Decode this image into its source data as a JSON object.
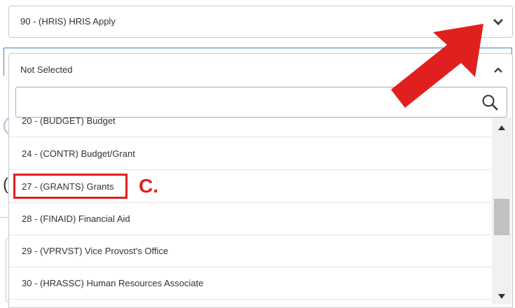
{
  "top_select": {
    "value": "90 - (HRIS) HRIS Apply",
    "icon": "chevron-down-icon"
  },
  "open_select": {
    "value": "Not Selected",
    "icon": "chevron-up-icon"
  },
  "search": {
    "placeholder": "",
    "icon": "search-icon"
  },
  "options": [
    "20 - (BUDGET) Budget",
    "24 - (CONTR) Budget/Grant",
    "27 - (GRANTS) Grants",
    "28 - (FINAID) Financial Aid",
    "29 - (VPRVST) Vice Provost's Office",
    "30 - (HRASSC) Human Resources Associate"
  ],
  "highlighted_option_index": 2,
  "annotation": {
    "label": "C.",
    "color": "#e0201e"
  },
  "colors": {
    "accent_border": "#4a7fc8",
    "highlight": "#e0201e",
    "arrow": "#e0201e"
  },
  "background": {
    "partial_letter": "("
  }
}
